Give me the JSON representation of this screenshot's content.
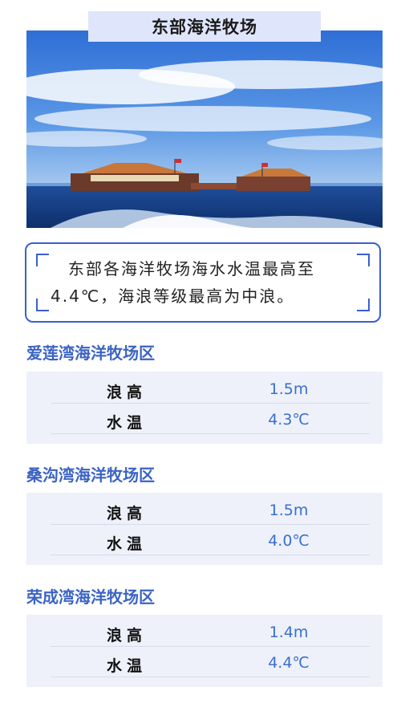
{
  "header": {
    "title": "东部海洋牧场"
  },
  "summary": {
    "text": "东部各海洋牧场海水水温最高至4.4℃，海浪等级最高为中浪。"
  },
  "zones": [
    {
      "name": "爱莲湾海洋牧场区",
      "rows": [
        {
          "label": "浪高",
          "value": "1.5m"
        },
        {
          "label": "水温",
          "value": "4.3℃"
        }
      ]
    },
    {
      "name": "桑沟湾海洋牧场区",
      "rows": [
        {
          "label": "浪高",
          "value": "1.5m"
        },
        {
          "label": "水温",
          "value": "4.0℃"
        }
      ]
    },
    {
      "name": "荣成湾海洋牧场区",
      "rows": [
        {
          "label": "浪高",
          "value": "1.4m"
        },
        {
          "label": "水温",
          "value": "4.4℃"
        }
      ]
    }
  ],
  "colors": {
    "accent": "#3b63c4",
    "title_bg": "#dfe6fb",
    "card_bg": "#eef1fa",
    "value": "#3a6fd0"
  }
}
